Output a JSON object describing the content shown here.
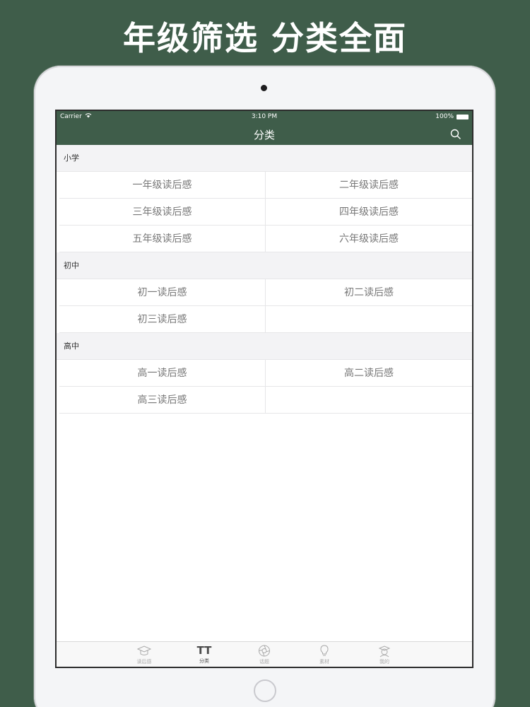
{
  "promo": {
    "headline": "年级筛选 分类全面"
  },
  "status_bar": {
    "carrier": "Carrier",
    "time": "3:10 PM",
    "battery": "100%"
  },
  "nav": {
    "title": "分类"
  },
  "sections": [
    {
      "header": "小学",
      "items": [
        "一年级读后感",
        "二年级读后感",
        "三年级读后感",
        "四年级读后感",
        "五年级读后感",
        "六年级读后感"
      ]
    },
    {
      "header": "初中",
      "items": [
        "初一读后感",
        "初二读后感",
        "初三读后感",
        ""
      ]
    },
    {
      "header": "高中",
      "items": [
        "高一读后感",
        "高二读后感",
        "高三读后感",
        ""
      ]
    }
  ],
  "tabs": [
    {
      "label": "读后感",
      "icon": "graduation-cap-icon"
    },
    {
      "label": "分类",
      "icon": "text-size-icon",
      "glyph": "TT"
    },
    {
      "label": "话题",
      "icon": "aperture-icon"
    },
    {
      "label": "素材",
      "icon": "lightbulb-icon"
    },
    {
      "label": "我的",
      "icon": "user-cap-icon"
    }
  ],
  "colors": {
    "brand": "#3f5d4a",
    "cell_text": "#777777",
    "section_bg": "#f3f3f5"
  }
}
